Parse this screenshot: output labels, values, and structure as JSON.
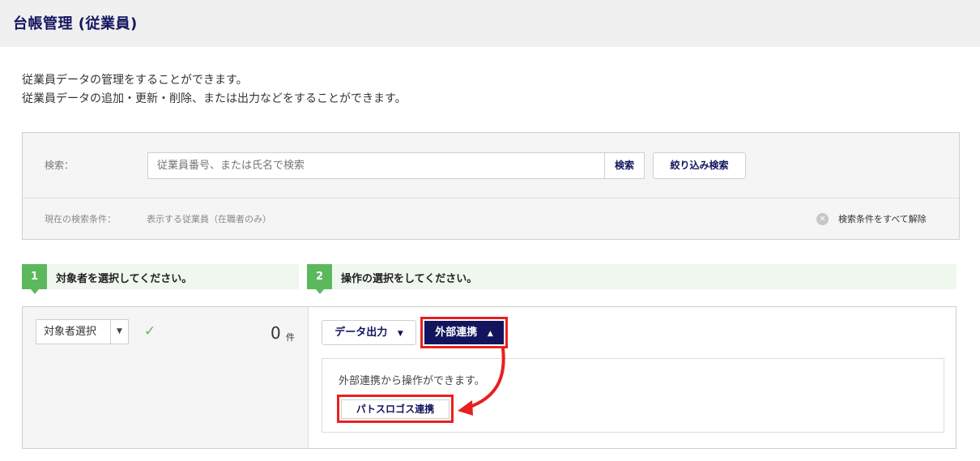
{
  "header": {
    "title": "台帳管理 (従業員)"
  },
  "description": {
    "line1": "従業員データの管理をすることができます。",
    "line2": "従業員データの追加・更新・削除、または出力などをすることができます。"
  },
  "search": {
    "label": "検索：",
    "placeholder": "従業員番号、または氏名で検索",
    "search_button": "検索",
    "filter_button": "絞り込み検索",
    "condition_label": "現在の検索条件：",
    "condition_value": "表示する従業員（在職者のみ）",
    "clear_all": "検索条件をすべて解除"
  },
  "steps": [
    {
      "number": "1",
      "text": "対象者を選択してください。"
    },
    {
      "number": "2",
      "text": "操作の選択をしてください。"
    }
  ],
  "selection": {
    "select_label": "対象者選択",
    "count": "0",
    "count_unit": "件"
  },
  "actions": {
    "export_label": "データ出力",
    "external_label": "外部連携",
    "external_panel_text": "外部連携から操作ができます。",
    "patos_button": "パトスロゴス連携"
  },
  "colors": {
    "navy": "#12155e",
    "green": "#5cb85c",
    "highlight_red": "#e8201f"
  }
}
